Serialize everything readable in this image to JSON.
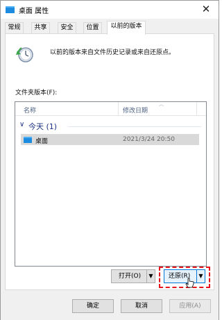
{
  "window": {
    "title": "桌面 属性",
    "icon": "folder-icon"
  },
  "tabs": [
    {
      "label": "常规",
      "active": false
    },
    {
      "label": "共享",
      "active": false
    },
    {
      "label": "安全",
      "active": false
    },
    {
      "label": "位置",
      "active": false
    },
    {
      "label": "以前的版本",
      "active": true
    }
  ],
  "panel": {
    "icon": "restore-clock-icon",
    "description": "以前的版本来自文件历史记录或来自还原点。",
    "folder_versions_label": "文件夹版本(F):"
  },
  "list": {
    "columns": {
      "name": "名称",
      "modified": "修改日期"
    },
    "group": {
      "label": "今天 (1)"
    },
    "rows": [
      {
        "name": "桌面",
        "date": "2021/3/24 20:50",
        "icon": "folder-icon",
        "selected": true
      }
    ]
  },
  "actions": {
    "open_label": "打开(O)",
    "restore_label": "还原(R)"
  },
  "footer": {
    "ok_label": "确定",
    "cancel_label": "取消",
    "apply_label": "应用(A)"
  },
  "colors": {
    "highlight_outline": "#e8141c",
    "folder": "#1d8be0",
    "group_text": "#1e3287"
  }
}
